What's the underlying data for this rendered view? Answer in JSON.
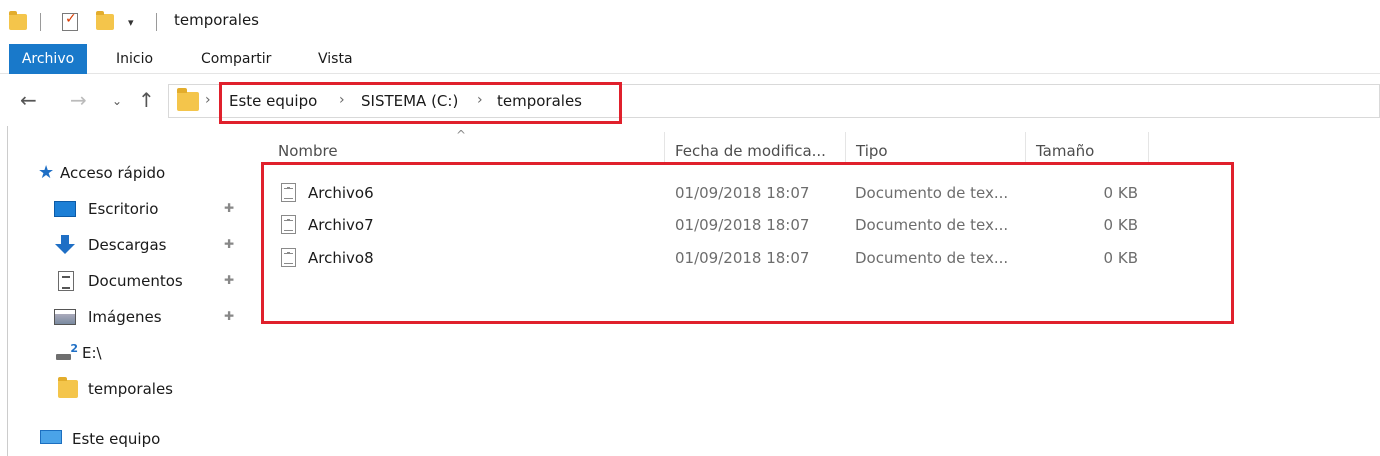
{
  "window": {
    "title": "temporales"
  },
  "ribbon": {
    "tabs": [
      "Archivo",
      "Inicio",
      "Compartir",
      "Vista"
    ]
  },
  "address": {
    "crumbs": [
      "Este equipo",
      "SISTEMA (C:)",
      "temporales"
    ]
  },
  "sidebar": {
    "items": [
      {
        "label": "Acceso rápido",
        "icon": "quick-access-star-icon",
        "pinned": false
      },
      {
        "label": "Escritorio",
        "icon": "desktop-icon",
        "pinned": true
      },
      {
        "label": "Descargas",
        "icon": "downloads-icon",
        "pinned": true
      },
      {
        "label": "Documentos",
        "icon": "documents-icon",
        "pinned": true
      },
      {
        "label": "Imágenes",
        "icon": "pictures-icon",
        "pinned": true
      },
      {
        "label": "E:\\",
        "icon": "drive-icon",
        "pinned": false
      },
      {
        "label": "temporales",
        "icon": "folder-icon",
        "pinned": false
      },
      {
        "label": "Este equipo",
        "icon": "this-pc-icon",
        "pinned": false
      }
    ]
  },
  "columns": {
    "name": "Nombre",
    "date": "Fecha de modifica...",
    "type": "Tipo",
    "size": "Tamaño"
  },
  "files": [
    {
      "name": "Archivo6",
      "date": "01/09/2018 18:07",
      "type": "Documento de tex...",
      "size": "0 KB"
    },
    {
      "name": "Archivo7",
      "date": "01/09/2018 18:07",
      "type": "Documento de tex...",
      "size": "0 KB"
    },
    {
      "name": "Archivo8",
      "date": "01/09/2018 18:07",
      "type": "Documento de tex...",
      "size": "0 KB"
    }
  ],
  "colors": {
    "highlight": "#e0202c",
    "file_tab": "#1979ca",
    "folder": "#f4c54b"
  }
}
